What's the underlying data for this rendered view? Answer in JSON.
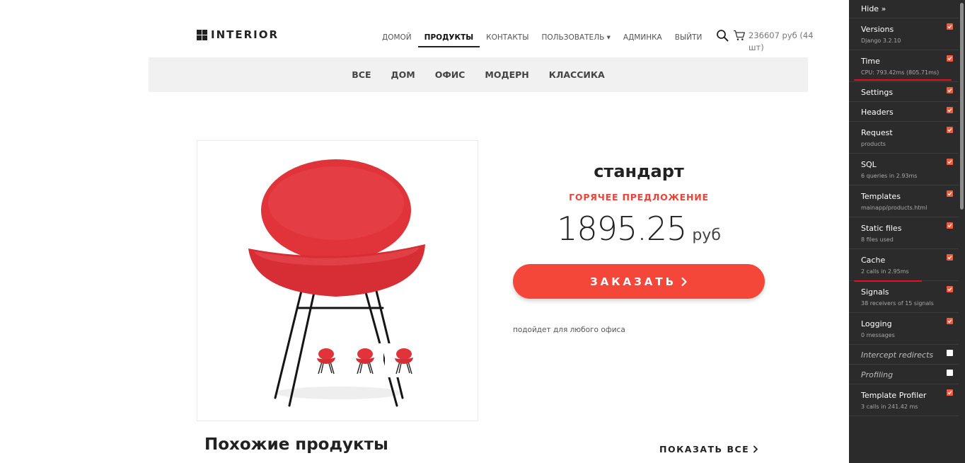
{
  "header": {
    "logo_text": "INTERIOR",
    "nav": [
      {
        "label": "домой",
        "active": false
      },
      {
        "label": "продукты",
        "active": true
      },
      {
        "label": "контакты",
        "active": false
      },
      {
        "label": "пользователь ▾",
        "active": false
      },
      {
        "label": "админка",
        "active": false
      },
      {
        "label": "выйти",
        "active": false
      }
    ],
    "search_icon": "search-icon",
    "cart_icon": "cart-icon",
    "cart_text": "236607 руб (44 шт)"
  },
  "categories": [
    "ВСЕ",
    "ДОМ",
    "ОФИС",
    "МОДЕРН",
    "КЛАССИКА"
  ],
  "product": {
    "name": "стандарт",
    "offer": "ГОРЯЧЕЕ ПРЕДЛОЖЕНИЕ",
    "price": "1895.25",
    "currency": "руб",
    "order_label": "ЗАКАЗАТЬ",
    "description": "подойдет для любого офиса",
    "accent_color": "#f4473a",
    "thumbnail_count": 3
  },
  "similar": {
    "title": "Похожие продукты",
    "show_all": "ПОКАЗАТЬ ВСЕ"
  },
  "debug_toolbar": {
    "hide_label": "Hide »",
    "panels": [
      {
        "title": "Versions",
        "subtitle": "Django 3.2.10",
        "checked": true
      },
      {
        "title": "Time",
        "subtitle": "CPU: 793.42ms (805.71ms)",
        "checked": true
      },
      {
        "title": "Settings",
        "subtitle": "",
        "checked": true
      },
      {
        "title": "Headers",
        "subtitle": "",
        "checked": true
      },
      {
        "title": "Request",
        "subtitle": "products",
        "checked": true
      },
      {
        "title": "SQL",
        "subtitle": "6 queries in 2.93ms",
        "checked": true
      },
      {
        "title": "Templates",
        "subtitle": "mainapp/products.html",
        "checked": true
      },
      {
        "title": "Static files",
        "subtitle": "8 files used",
        "checked": true
      },
      {
        "title": "Cache",
        "subtitle": "2 calls in 2.95ms",
        "checked": true
      },
      {
        "title": "Signals",
        "subtitle": "38 receivers of 15 signals",
        "checked": true
      },
      {
        "title": "Logging",
        "subtitle": "0 messages",
        "checked": true
      },
      {
        "title": "Intercept redirects",
        "subtitle": "",
        "checked": false
      },
      {
        "title": "Profiling",
        "subtitle": "",
        "checked": false
      },
      {
        "title": "Template Profiler",
        "subtitle": "3 calls in 241.42 ms",
        "checked": true
      }
    ]
  },
  "annotation_color": "#e8101b"
}
